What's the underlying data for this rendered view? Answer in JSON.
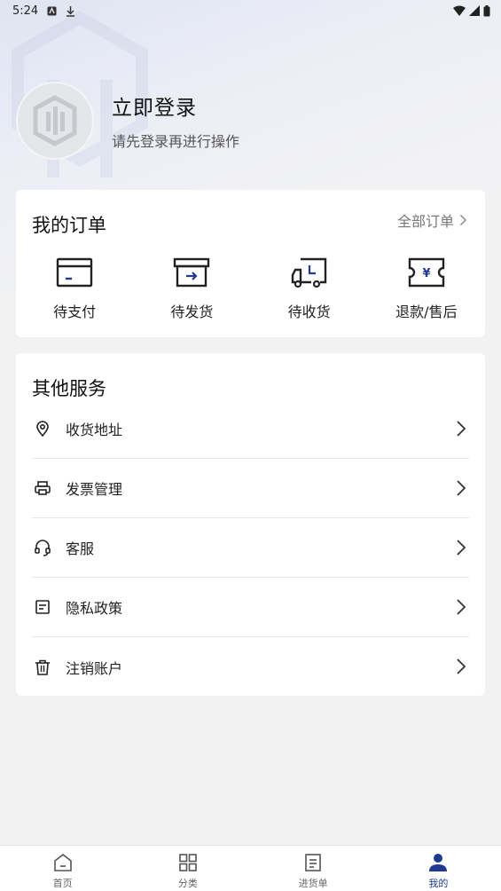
{
  "status_bar": {
    "time": "5:24"
  },
  "profile": {
    "title": "立即登录",
    "subtitle": "请先登录再进行操作"
  },
  "orders": {
    "title": "我的订单",
    "all_label": "全部订单",
    "items": [
      {
        "label": "待支付",
        "icon": "card-icon"
      },
      {
        "label": "待发货",
        "icon": "box-icon"
      },
      {
        "label": "待收货",
        "icon": "truck-icon"
      },
      {
        "label": "退款/售后",
        "icon": "refund-icon"
      }
    ]
  },
  "services": {
    "title": "其他服务",
    "items": [
      {
        "label": "收货地址",
        "icon": "location-icon"
      },
      {
        "label": "发票管理",
        "icon": "printer-icon"
      },
      {
        "label": "客服",
        "icon": "headset-icon"
      },
      {
        "label": "隐私政策",
        "icon": "document-icon"
      },
      {
        "label": "注销账户",
        "icon": "trash-icon"
      }
    ]
  },
  "tabbar": {
    "active": 3,
    "items": [
      {
        "label": "首页",
        "icon": "home-icon"
      },
      {
        "label": "分类",
        "icon": "grid-icon"
      },
      {
        "label": "进货单",
        "icon": "list-icon"
      },
      {
        "label": "我的",
        "icon": "user-icon"
      }
    ]
  },
  "colors": {
    "accent": "#1f3a8f",
    "background": "#f2f2f2",
    "card": "#ffffff"
  }
}
